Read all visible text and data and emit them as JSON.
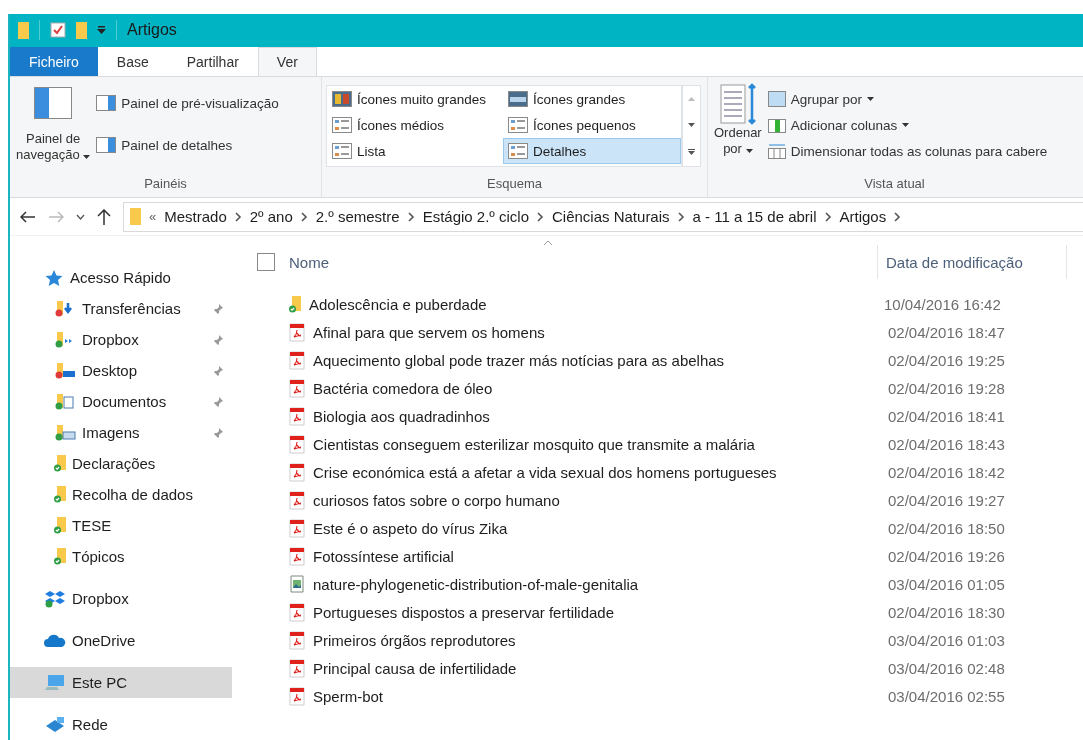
{
  "window": {
    "title": "Artigos"
  },
  "ribbon_tabs": [
    {
      "label": "Ficheiro",
      "kind": "file",
      "selected": false
    },
    {
      "label": "Base",
      "kind": "tab",
      "selected": false
    },
    {
      "label": "Partilhar",
      "kind": "tab",
      "selected": false
    },
    {
      "label": "Ver",
      "kind": "tab",
      "selected": true
    }
  ],
  "ribbon": {
    "panes": {
      "group": "Painéis",
      "navigation": [
        "Painel de",
        "navegação"
      ],
      "preview": "Painel de pré-visualização",
      "details": "Painel de detalhes"
    },
    "layout": {
      "group": "Esquema",
      "options": [
        {
          "label": "Ícones muito grandes",
          "selected": false
        },
        {
          "label": "Ícones grandes",
          "selected": false
        },
        {
          "label": "Ícones médios",
          "selected": false
        },
        {
          "label": "Ícones pequenos",
          "selected": false
        },
        {
          "label": "Lista",
          "selected": false
        },
        {
          "label": "Detalhes",
          "selected": true
        }
      ]
    },
    "current_view": {
      "group": "Vista atual",
      "sort": [
        "Ordenar",
        "por"
      ],
      "group_by": "Agrupar por",
      "add_columns": "Adicionar colunas",
      "fit_columns": "Dimensionar todas as colunas para cabere"
    }
  },
  "address": {
    "overflow": "«",
    "path": [
      "Mestrado",
      "2º ano",
      "2.º semestre",
      "Estágio 2.º ciclo",
      "Ciências Naturais",
      "a - 11 a 15 de abril",
      "Artigos"
    ]
  },
  "sidebar": {
    "items": [
      {
        "label": "Acesso Rápido",
        "kind": "star",
        "selected": false,
        "children": [
          {
            "label": "Transferências",
            "kind": "downloads",
            "pinned": true,
            "selected": false
          },
          {
            "label": "Dropbox",
            "kind": "dropbox-folder",
            "pinned": true,
            "selected": false
          },
          {
            "label": "Desktop",
            "kind": "desktop",
            "pinned": true,
            "selected": false
          },
          {
            "label": "Documentos",
            "kind": "documents",
            "pinned": true,
            "selected": false
          },
          {
            "label": "Imagens",
            "kind": "pictures",
            "pinned": true,
            "selected": false
          },
          {
            "label": "Declarações",
            "kind": "folder",
            "pinned": false,
            "selected": false
          },
          {
            "label": "Recolha de dados",
            "kind": "folder",
            "pinned": false,
            "selected": false
          },
          {
            "label": "TESE",
            "kind": "folder",
            "pinned": false,
            "selected": false
          },
          {
            "label": "Tópicos",
            "kind": "folder",
            "pinned": false,
            "selected": false
          }
        ]
      },
      {
        "label": "Dropbox",
        "kind": "dropbox",
        "selected": false
      },
      {
        "label": "OneDrive",
        "kind": "cloud",
        "selected": false
      },
      {
        "label": "Este PC",
        "kind": "pc",
        "selected": true
      },
      {
        "label": "Rede",
        "kind": "network",
        "selected": false
      }
    ]
  },
  "table": {
    "columns": [
      "Nome",
      "Data de modificação"
    ],
    "checked": false,
    "rows": [
      {
        "name": "Adolescência e puberdade",
        "kind": "folder",
        "date": "10/04/2016 16:42"
      },
      {
        "name": "Afinal para que servem os homens",
        "kind": "pdf",
        "date": "02/04/2016 18:47"
      },
      {
        "name": "Aquecimento global pode trazer más notícias para as abelhas",
        "kind": "pdf",
        "date": "02/04/2016 19:25"
      },
      {
        "name": "Bactéria comedora de óleo",
        "kind": "pdf",
        "date": "02/04/2016 19:28"
      },
      {
        "name": "Biologia aos quadradinhos",
        "kind": "pdf",
        "date": "02/04/2016 18:41"
      },
      {
        "name": "Cientistas conseguem esterilizar mosquito que transmite a malária",
        "kind": "pdf",
        "date": "02/04/2016 18:43"
      },
      {
        "name": "Crise económica está a afetar a vida sexual dos homens portugueses",
        "kind": "pdf",
        "date": "02/04/2016 18:42"
      },
      {
        "name": "curiosos fatos sobre o corpo humano",
        "kind": "pdf",
        "date": "02/04/2016 19:27"
      },
      {
        "name": "Este é o aspeto do vírus Zika",
        "kind": "pdf",
        "date": "02/04/2016 18:50"
      },
      {
        "name": "Fotossíntese artificial",
        "kind": "pdf",
        "date": "02/04/2016 19:26"
      },
      {
        "name": "nature-phylogenetic-distribution-of-male-genitalia",
        "kind": "image",
        "date": "03/04/2016 01:05"
      },
      {
        "name": "Portugueses dispostos a preservar fertilidade",
        "kind": "pdf",
        "date": "02/04/2016 18:30"
      },
      {
        "name": "Primeiros órgãos reprodutores",
        "kind": "pdf",
        "date": "03/04/2016 01:03"
      },
      {
        "name": "Principal causa de infertilidade",
        "kind": "pdf",
        "date": "03/04/2016 02:48"
      },
      {
        "name": "Sperm-bot",
        "kind": "pdf",
        "date": "03/04/2016 02:55"
      }
    ]
  }
}
